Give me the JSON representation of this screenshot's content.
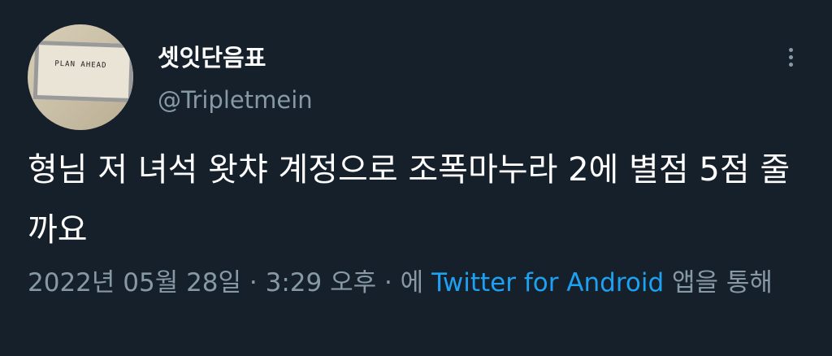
{
  "author": {
    "display_name": "셋잇단음표",
    "handle": "@Tripletmein",
    "avatar_text": "PLAN AHEAD"
  },
  "tweet": {
    "text": "형님 저 녀석 왓챠 계정으로 조폭마누라 2에 별점 5점 줄까요",
    "timestamp": "2022년 05월 28일 · 3:29 오후 · 에 ",
    "source": "Twitter for Android",
    "source_suffix": " 앱을 통해"
  },
  "icons": {
    "more": "more-vertical-icon"
  },
  "colors": {
    "background": "#15202b",
    "text": "#ffffff",
    "secondary": "#8899a6",
    "link": "#1da1f2"
  }
}
